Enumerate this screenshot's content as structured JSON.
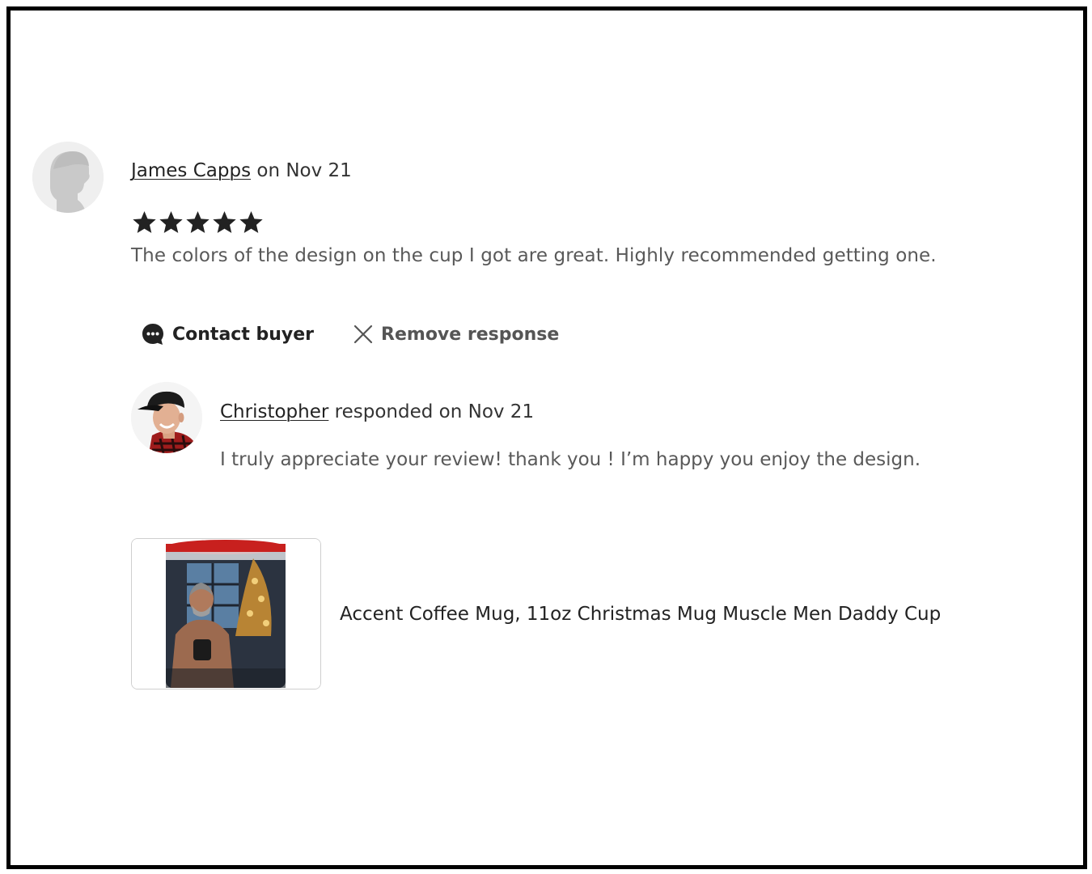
{
  "review": {
    "reviewer_name": "James Capps",
    "date_text": " on Nov 21",
    "rating": 5,
    "rating_max": 5,
    "text": "The colors of the design on the cup I got are great. Highly recommended getting one."
  },
  "actions": {
    "contact_label": "Contact buyer",
    "remove_label": "Remove response"
  },
  "response": {
    "seller_name": "Christopher",
    "date_text": " responded on Nov 21",
    "text": "I truly appreciate your review! thank you ! I’m happy you enjoy the design."
  },
  "product": {
    "title": "Accent Coffee Mug, 11oz Christmas Mug Muscle Men Daddy Cup"
  },
  "colors": {
    "text": "#222222",
    "muted": "#595959",
    "star": "#222222",
    "mug_rim": "#c8201e"
  },
  "icons": {
    "contact": "chat-bubble-icon",
    "remove": "close-icon",
    "star": "star-icon"
  }
}
